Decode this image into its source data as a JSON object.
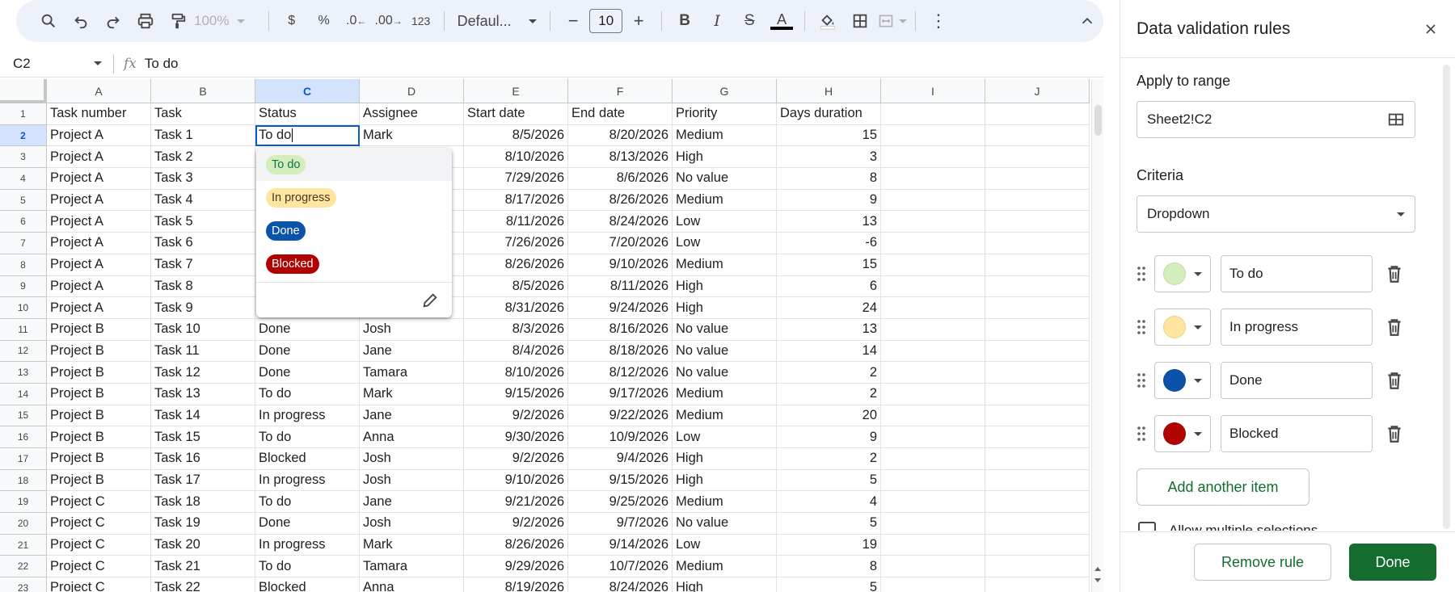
{
  "toolbar": {
    "zoom": "100%",
    "currency": "$",
    "percent": "%",
    "decrease_decimal": ".0",
    "increase_decimal": ".00",
    "number_format": "123",
    "font": "Defaul...",
    "font_size": "10"
  },
  "formula_bar": {
    "name_box": "C2",
    "fx": "fx",
    "value": "To do"
  },
  "grid": {
    "columns": [
      "A",
      "B",
      "C",
      "D",
      "E",
      "F",
      "G",
      "H",
      "I",
      "J"
    ],
    "rows": [
      [
        "Task number",
        "Task",
        "Status",
        "Assignee",
        "Start date",
        "End date",
        "Priority",
        "Days duration",
        "",
        ""
      ],
      [
        "Project A",
        "Task 1",
        "To do",
        "Mark",
        "8/5/2026",
        "8/20/2026",
        "Medium",
        "15",
        "",
        ""
      ],
      [
        "Project A",
        "Task 2",
        "",
        "",
        "8/10/2026",
        "8/13/2026",
        "High",
        "3",
        "",
        ""
      ],
      [
        "Project A",
        "Task 3",
        "",
        "",
        "7/29/2026",
        "8/6/2026",
        "No value",
        "8",
        "",
        ""
      ],
      [
        "Project A",
        "Task 4",
        "",
        "",
        "8/17/2026",
        "8/26/2026",
        "Medium",
        "9",
        "",
        ""
      ],
      [
        "Project A",
        "Task 5",
        "",
        "",
        "8/11/2026",
        "8/24/2026",
        "Low",
        "13",
        "",
        ""
      ],
      [
        "Project A",
        "Task 6",
        "",
        "",
        "7/26/2026",
        "7/20/2026",
        "Low",
        "-6",
        "",
        ""
      ],
      [
        "Project A",
        "Task 7",
        "",
        "",
        "8/26/2026",
        "9/10/2026",
        "Medium",
        "15",
        "",
        ""
      ],
      [
        "Project A",
        "Task 8",
        "",
        "",
        "8/5/2026",
        "8/11/2026",
        "High",
        "6",
        "",
        ""
      ],
      [
        "Project A",
        "Task 9",
        "",
        "",
        "8/31/2026",
        "9/24/2026",
        "High",
        "24",
        "",
        ""
      ],
      [
        "Project B",
        "Task 10",
        "Done",
        "Josh",
        "8/3/2026",
        "8/16/2026",
        "No value",
        "13",
        "",
        ""
      ],
      [
        "Project B",
        "Task 11",
        "Done",
        "Jane",
        "8/4/2026",
        "8/18/2026",
        "No value",
        "14",
        "",
        ""
      ],
      [
        "Project B",
        "Task 12",
        "Done",
        "Tamara",
        "8/10/2026",
        "8/12/2026",
        "No value",
        "2",
        "",
        ""
      ],
      [
        "Project B",
        "Task 13",
        "To do",
        "Mark",
        "9/15/2026",
        "9/17/2026",
        "Medium",
        "2",
        "",
        ""
      ],
      [
        "Project B",
        "Task 14",
        "In progress",
        "Jane",
        "9/2/2026",
        "9/22/2026",
        "Medium",
        "20",
        "",
        ""
      ],
      [
        "Project B",
        "Task 15",
        "To do",
        "Anna",
        "9/30/2026",
        "10/9/2026",
        "Low",
        "9",
        "",
        ""
      ],
      [
        "Project B",
        "Task 16",
        "Blocked",
        "Josh",
        "9/2/2026",
        "9/4/2026",
        "High",
        "2",
        "",
        ""
      ],
      [
        "Project B",
        "Task 17",
        "In progress",
        "Josh",
        "9/10/2026",
        "9/15/2026",
        "High",
        "5",
        "",
        ""
      ],
      [
        "Project C",
        "Task 18",
        "To do",
        "Jane",
        "9/21/2026",
        "9/25/2026",
        "Medium",
        "4",
        "",
        ""
      ],
      [
        "Project C",
        "Task 19",
        "Done",
        "Josh",
        "9/2/2026",
        "9/7/2026",
        "No value",
        "5",
        "",
        ""
      ],
      [
        "Project C",
        "Task 20",
        "In progress",
        "Mark",
        "8/26/2026",
        "9/14/2026",
        "Low",
        "19",
        "",
        ""
      ],
      [
        "Project C",
        "Task 21",
        "To do",
        "Tamara",
        "9/29/2026",
        "10/7/2026",
        "Medium",
        "8",
        "",
        ""
      ],
      [
        "Project C",
        "Task 22",
        "Blocked",
        "Anna",
        "8/19/2026",
        "8/24/2026",
        "High",
        "5",
        "",
        ""
      ]
    ]
  },
  "dropdown": {
    "options": [
      {
        "label": "To do",
        "bg": "#d4edbc",
        "fg": "#11734b"
      },
      {
        "label": "In progress",
        "bg": "#ffe5a0",
        "fg": "#473821"
      },
      {
        "label": "Done",
        "bg": "#0a53a8",
        "fg": "#ffffff"
      },
      {
        "label": "Blocked",
        "bg": "#b10202",
        "fg": "#ffffff"
      }
    ]
  },
  "panel": {
    "title": "Data validation rules",
    "apply_label": "Apply to range",
    "range": "Sheet2!C2",
    "criteria_label": "Criteria",
    "criteria": "Dropdown",
    "items": [
      {
        "label": "To do",
        "color": "#d4edbc"
      },
      {
        "label": "In progress",
        "color": "#ffe5a0"
      },
      {
        "label": "Done",
        "color": "#0a53a8"
      },
      {
        "label": "Blocked",
        "color": "#b10202"
      }
    ],
    "add_item": "Add another item",
    "multi_label": "Allow multiple selections",
    "remove_rule": "Remove rule",
    "done": "Done"
  }
}
